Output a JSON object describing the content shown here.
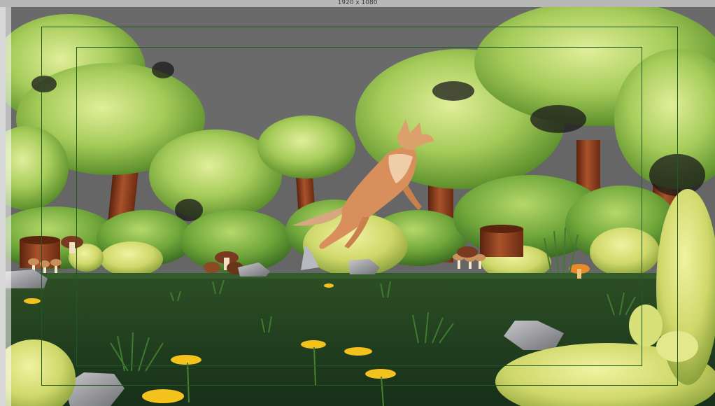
{
  "viewport": {
    "resolution_gate_label": "1920 x 1080"
  },
  "scene": {
    "colors": {
      "sky": "#666666",
      "ground": "#1f3d1d",
      "foliage_light": "#c9df7c",
      "foliage_mid": "#8fbf4a",
      "foliage_dark": "#4d8a2c",
      "trunk": "#8b3a1a",
      "fox": "#d98f5c",
      "flower": "#f3c21d",
      "safe_frame": "#1f5a1f"
    }
  }
}
